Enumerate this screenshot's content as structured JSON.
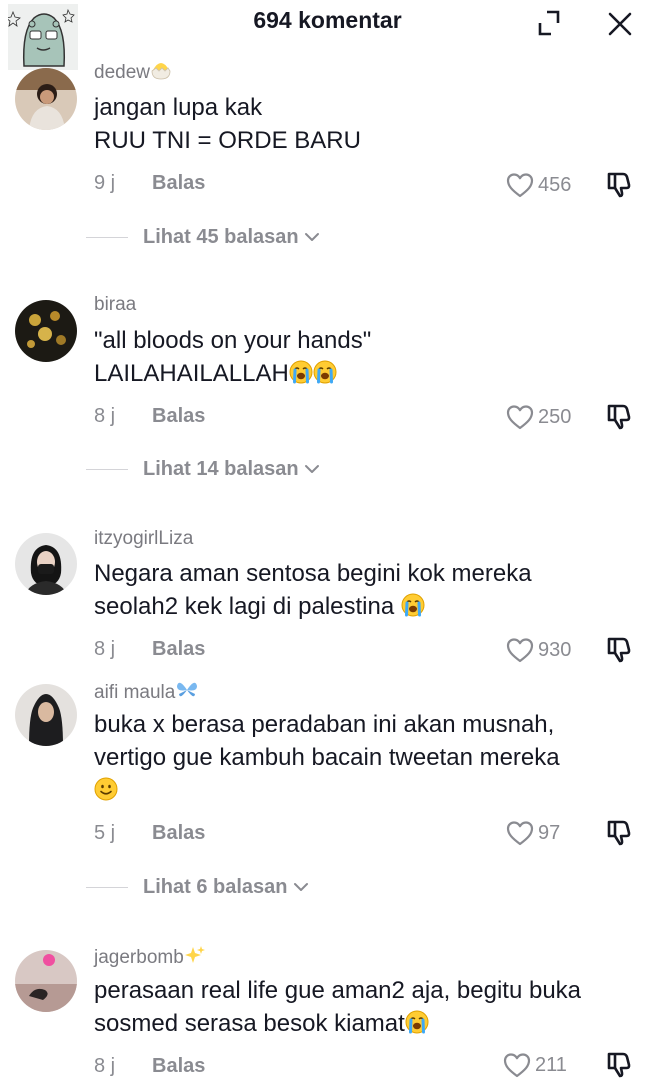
{
  "header": {
    "title": "694 komentar",
    "expand_icon": "expand-icon",
    "close_icon": "close-icon"
  },
  "colors": {
    "text": "#161823",
    "muted": "#8a8b91",
    "username": "#7a7a80",
    "divider": "#d4d4d8"
  },
  "comments": [
    {
      "username": "dedew",
      "username_suffix_icon": "hatching-chick-icon",
      "lines": [
        "jangan lupa kak",
        "RUU TNI = ORDE BARU"
      ],
      "time": "9 j",
      "reply_label": "Balas",
      "likes": "456",
      "replies_label": "Lihat 45 balasan"
    },
    {
      "username": "biraa",
      "lines": [
        "\"all bloods on your hands\"",
        "LAILAHAILALLAH"
      ],
      "line_emoji": [
        "",
        "loudly-crying-face x2"
      ],
      "time": "8 j",
      "reply_label": "Balas",
      "likes": "250",
      "replies_label": "Lihat 14 balasan"
    },
    {
      "username": "itzyogirlLiza",
      "lines": [
        "Negara aman sentosa begini kok mereka",
        "seolah2 kek lagi di palestina"
      ],
      "line_emoji": [
        "",
        "loudly-crying-face"
      ],
      "time": "8 j",
      "reply_label": "Balas",
      "likes": "930"
    },
    {
      "username": "aifi maula",
      "username_suffix_icon": "butterfly-icon",
      "lines": [
        "buka x berasa peradaban ini akan musnah,",
        "vertigo gue kambuh bacain tweetan mereka"
      ],
      "trailing_emoji": "slightly-smiling-face",
      "time": "5 j",
      "reply_label": "Balas",
      "likes": "97",
      "replies_label": "Lihat 6 balasan"
    },
    {
      "username": "jagerbomb",
      "username_suffix_icon": "sparkles-icon",
      "lines": [
        "perasaan real life gue aman2 aja, begitu buka",
        "sosmed serasa besok kiamat"
      ],
      "line_emoji": [
        "",
        "loudly-crying-face"
      ],
      "time": "8 j",
      "reply_label": "Balas",
      "likes": "211"
    }
  ]
}
